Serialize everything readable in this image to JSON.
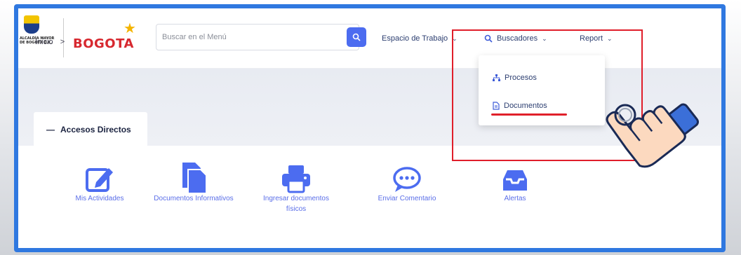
{
  "logo": {
    "alcaldia_text": "ALCALDÍA MAYOR DE BOGOTÁ D.C.",
    "brand_text": "BOGOTA"
  },
  "search": {
    "placeholder": "Buscar en el Menú"
  },
  "nav": {
    "workspace_label": "Espacio de Trabajo",
    "finders_label": "Buscadores",
    "report_label": "Report"
  },
  "dropdown": {
    "items": [
      {
        "label": "Procesos",
        "icon": "sitemap-icon"
      },
      {
        "label": "Documentos",
        "icon": "document-icon"
      }
    ]
  },
  "breadcrumb": {
    "home": "Inicio",
    "separator": ">"
  },
  "section": {
    "toggle": "—",
    "title": "Accesos Directos"
  },
  "shortcuts": [
    {
      "label": "Mis Actividades",
      "icon": "edit-icon"
    },
    {
      "label": "Documentos Informativos",
      "icon": "file-stack-icon"
    },
    {
      "label": "Ingresar documentos físicos",
      "icon": "printer-icon"
    },
    {
      "label": "Enviar Comentario",
      "icon": "chat-icon"
    },
    {
      "label": "Alertas",
      "icon": "inbox-icon"
    }
  ],
  "colors": {
    "frame_border": "#2f78e0",
    "accent": "#4c6cf0",
    "highlight": "#e01e2a",
    "shortcut_text": "#5a6ee8"
  }
}
